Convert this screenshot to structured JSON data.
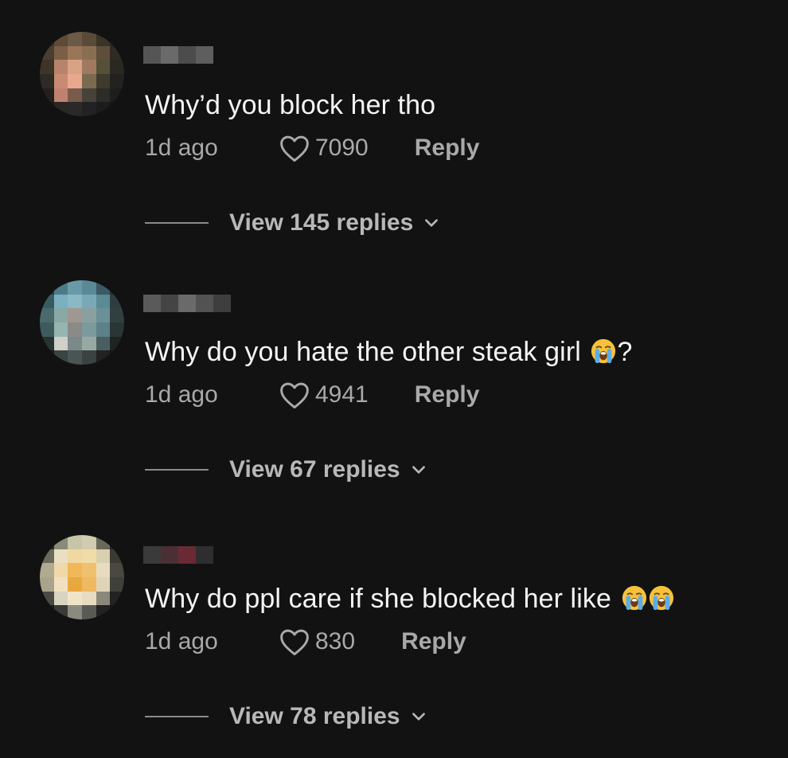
{
  "comments": [
    {
      "text": "Why’d you block her tho",
      "time": "1d ago",
      "likes": "7090",
      "reply_label": "Reply",
      "view_replies": "View 145 replies",
      "emoji_after": [],
      "suffix": ""
    },
    {
      "text": "Why do you hate the other steak girl ",
      "time": "1d ago",
      "likes": "4941",
      "reply_label": "Reply",
      "view_replies": "View 67 replies",
      "emoji_after": [
        "loudly-crying-face"
      ],
      "suffix": "?"
    },
    {
      "text": "Why do ppl care if she blocked her like ",
      "time": "1d ago",
      "likes": "830",
      "reply_label": "Reply",
      "view_replies": "View 78 replies",
      "emoji_after": [
        "loudly-crying-face",
        "loudly-crying-face"
      ],
      "suffix": ""
    }
  ],
  "colors": {
    "background": "#121212",
    "text": "#f5f5f5",
    "muted": "#a9a9a9"
  }
}
